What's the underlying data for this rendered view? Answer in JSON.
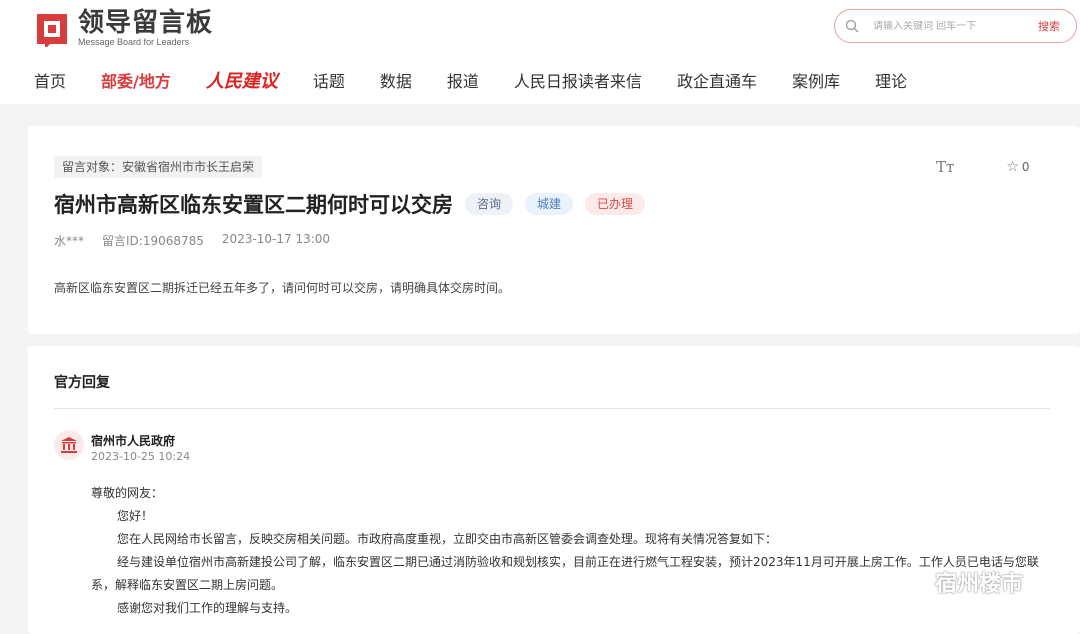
{
  "header": {
    "logo_title": "领导留言板",
    "logo_sub": "Message Board for Leaders",
    "search_placeholder": "请输入关键词 回车一下",
    "search_button": "搜索",
    "nav": [
      {
        "label": "首页"
      },
      {
        "label": "部委/地方"
      },
      {
        "label": "人民建议"
      },
      {
        "label": "话题"
      },
      {
        "label": "数据"
      },
      {
        "label": "报道"
      },
      {
        "label": "人民日报读者来信"
      },
      {
        "label": "政企直通车"
      },
      {
        "label": "案例库"
      },
      {
        "label": "理论"
      }
    ],
    "active_nav": "部委/地方"
  },
  "message": {
    "target": "留言对象：安徽省宿州市市长王启荣",
    "font_toggle": "Tт",
    "favorite_count": "0",
    "title": "宿州市高新区临东安置区二期何时可以交房",
    "tags": [
      "咨询",
      "城建",
      "已办理"
    ],
    "author": "水***",
    "message_id": "留言ID:19068785",
    "date": "2023-10-17 13:00",
    "content": "高新区临东安置区二期拆迁已经五年多了，请问何时可以交房，请明确具体交房时间。"
  },
  "reply": {
    "heading": "官方回复",
    "org": "宿州市人民政府",
    "time": "2023-10-25 10:24",
    "salutation": "尊敬的网友：",
    "greeting": "您好！",
    "para1": "您在人民网给市长留言，反映交房相关问题。市政府高度重视，立即交由市高新区管委会调查处理。现将有关情况答复如下：",
    "para2": "经与建设单位宿州市高新建投公司了解，临东安置区二期已通过消防验收和规划核实，目前正在进行燃气工程安装，预计2023年11月可开展上房工作。工作人员已电话与您联系，解释临东安置区二期上房问题。",
    "para3": "感谢您对我们工作的理解与支持。"
  },
  "watermark": {
    "text": "宿州楼市"
  },
  "colors": {
    "accent": "#d93c3c",
    "background": "#f4f4f4"
  }
}
